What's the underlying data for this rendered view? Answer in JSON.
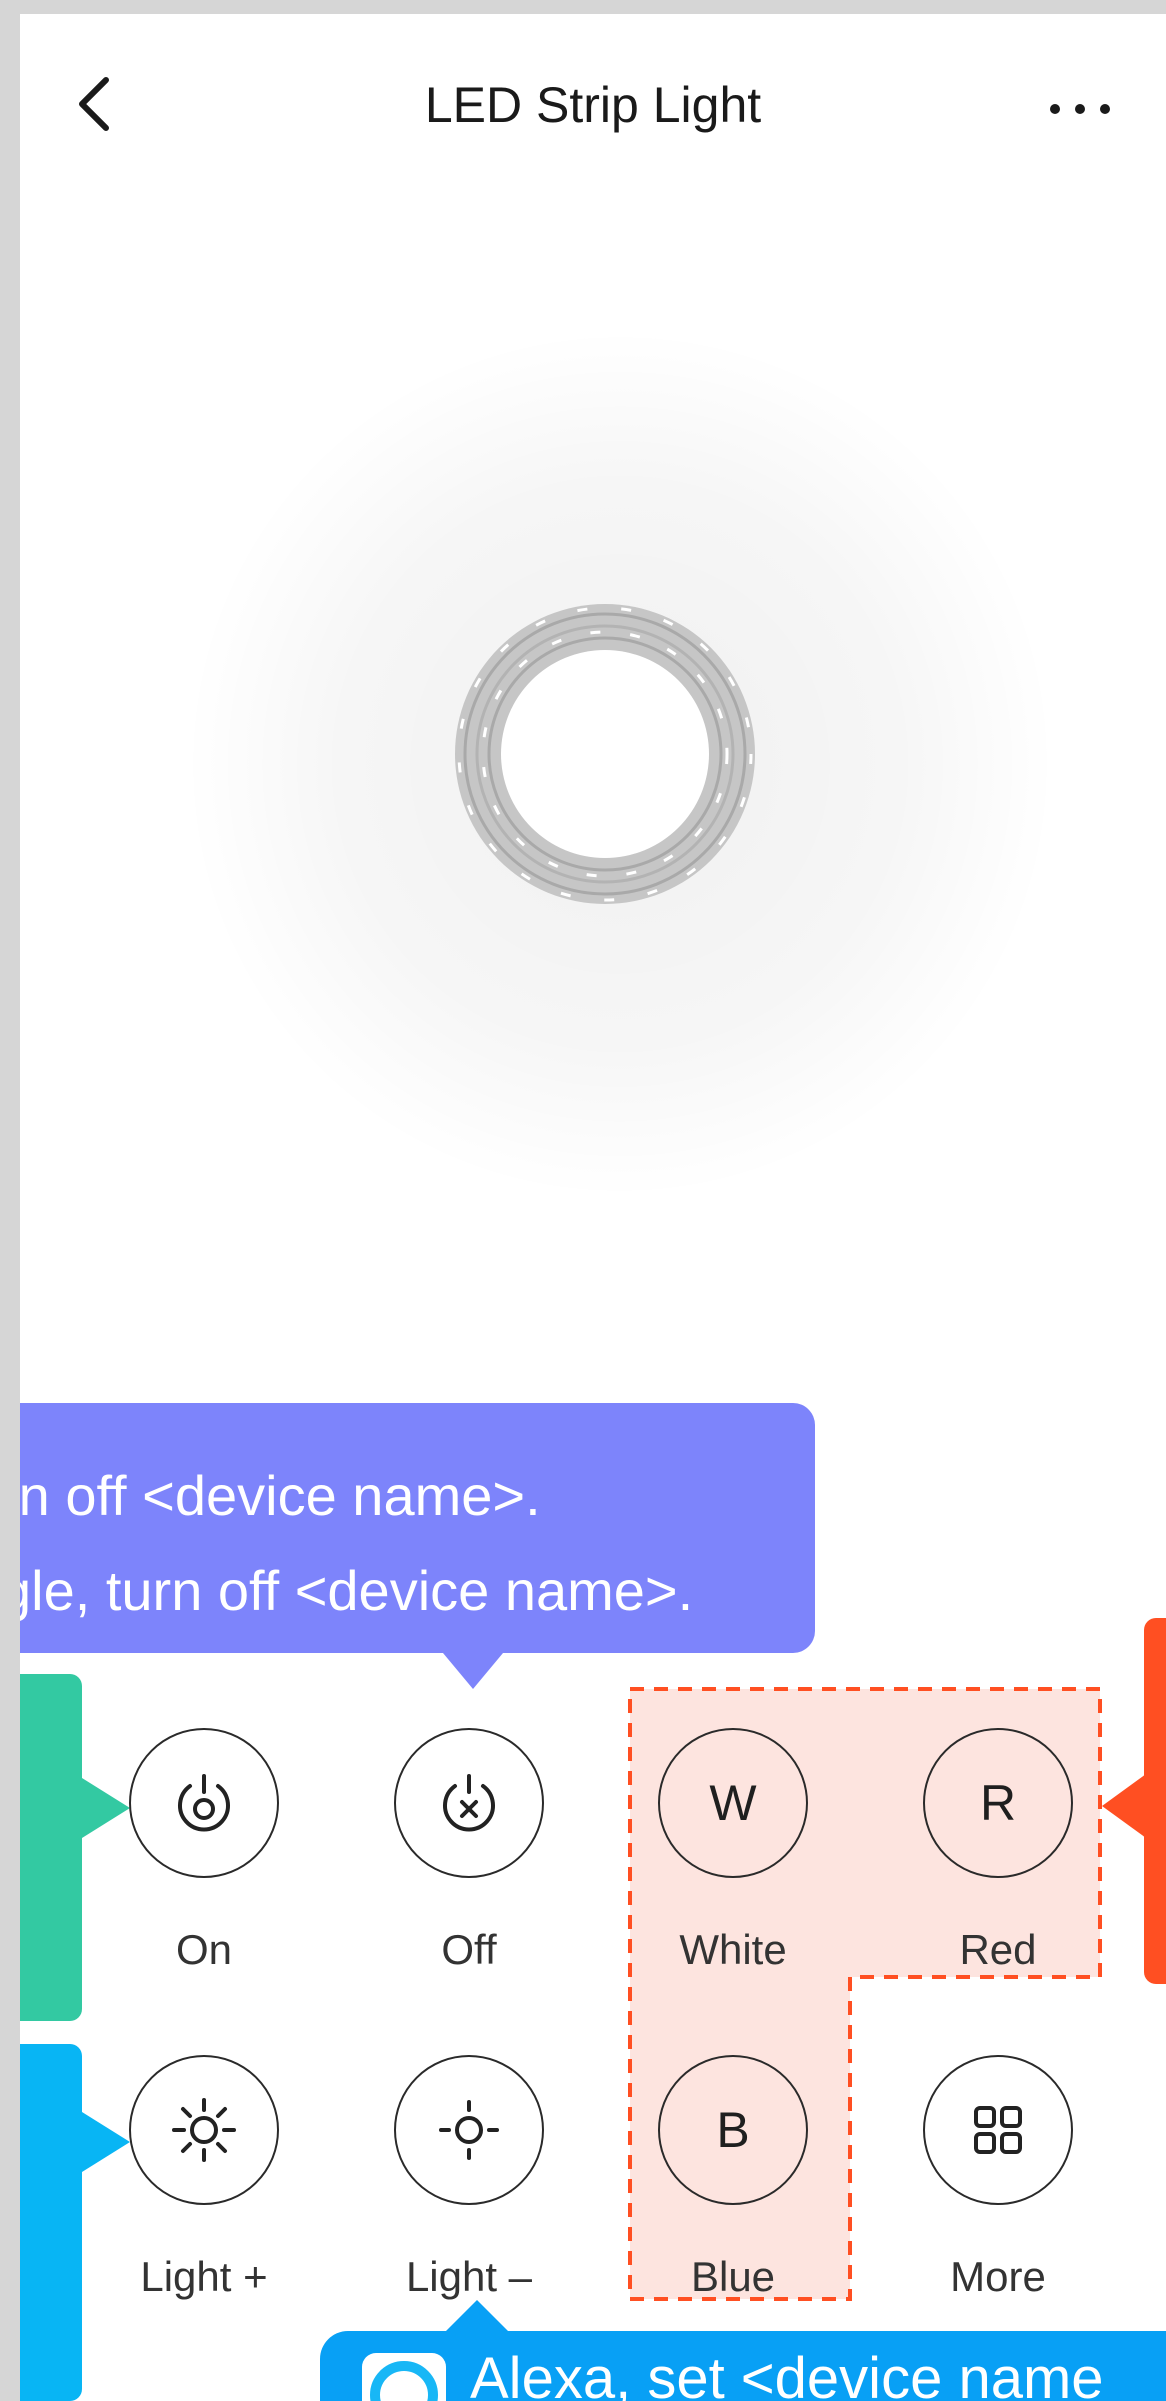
{
  "header": {
    "title": "LED Strip Light",
    "back_icon": "chevron-left-icon",
    "more_icon": "ellipsis-icon"
  },
  "callouts": {
    "purple": {
      "line1": "rn off <device name>.",
      "line2": "gle, turn off <device name>.",
      "color": "#7d84fb"
    },
    "alexa": {
      "text": "Alexa, set <device name",
      "color": "#08a0f5"
    },
    "green_color": "#33c9a2",
    "blue_color": "#08b5f4",
    "red_color": "#ff4f22",
    "red_region_fill": "#fde4df"
  },
  "controls": [
    {
      "id": "on",
      "label": "On",
      "icon": "power-on-icon"
    },
    {
      "id": "off",
      "label": "Off",
      "icon": "power-off-icon"
    },
    {
      "id": "white",
      "label": "White",
      "glyph": "W"
    },
    {
      "id": "red",
      "label": "Red",
      "glyph": "R"
    },
    {
      "id": "light-up",
      "label": "Light +",
      "icon": "brightness-up-icon"
    },
    {
      "id": "light-down",
      "label": "Light –",
      "icon": "brightness-down-icon"
    },
    {
      "id": "blue",
      "label": "Blue",
      "glyph": "B"
    },
    {
      "id": "more",
      "label": "More",
      "icon": "grid-icon"
    }
  ]
}
